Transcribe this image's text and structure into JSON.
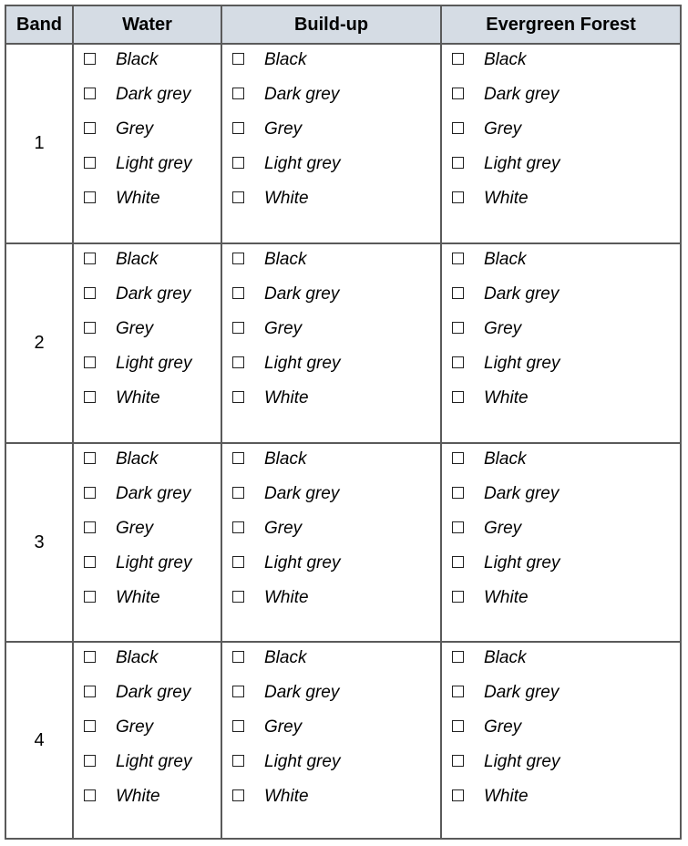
{
  "table": {
    "headers": [
      "Band",
      "Water",
      "Build-up",
      "Evergreen Forest"
    ],
    "bands": [
      "1",
      "2",
      "3",
      "4"
    ],
    "options": [
      "Black",
      "Dark grey",
      "Grey",
      "Light grey",
      "White"
    ]
  },
  "colors": {
    "header_bg": "#d5dce4",
    "border": "#5a5a5a"
  }
}
